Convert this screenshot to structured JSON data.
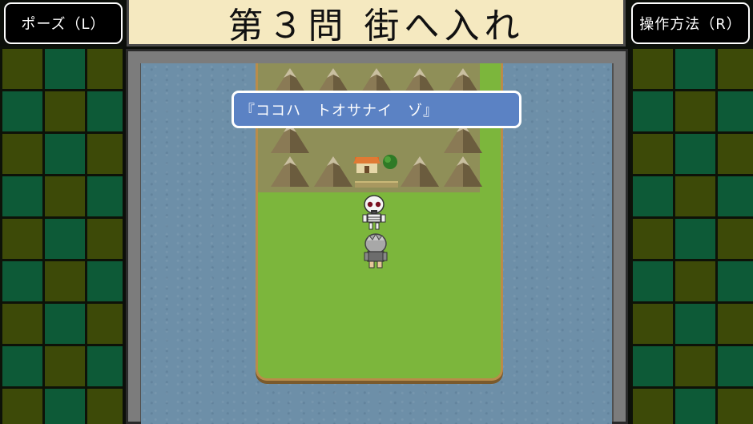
{
  "header": {
    "pause_label": "ポーズ（L）",
    "controls_label": "操作方法（R）",
    "title": "第３問 街へ入れ"
  },
  "dialog": {
    "text": "『ココハ　トオサナイ　ゾ』"
  },
  "icons": {
    "enemy": "skeleton-icon",
    "player": "player-character-icon",
    "village": "village-house-icon",
    "terrain": "mountain-icon"
  },
  "colors": {
    "title_bg": "#f5e9c0",
    "dialog_bg": "#5b82c4",
    "water": "#6d8fa8",
    "grass": "#7cb63c",
    "checker_green": "#0d5a37",
    "checker_olive": "#3d4a08"
  }
}
